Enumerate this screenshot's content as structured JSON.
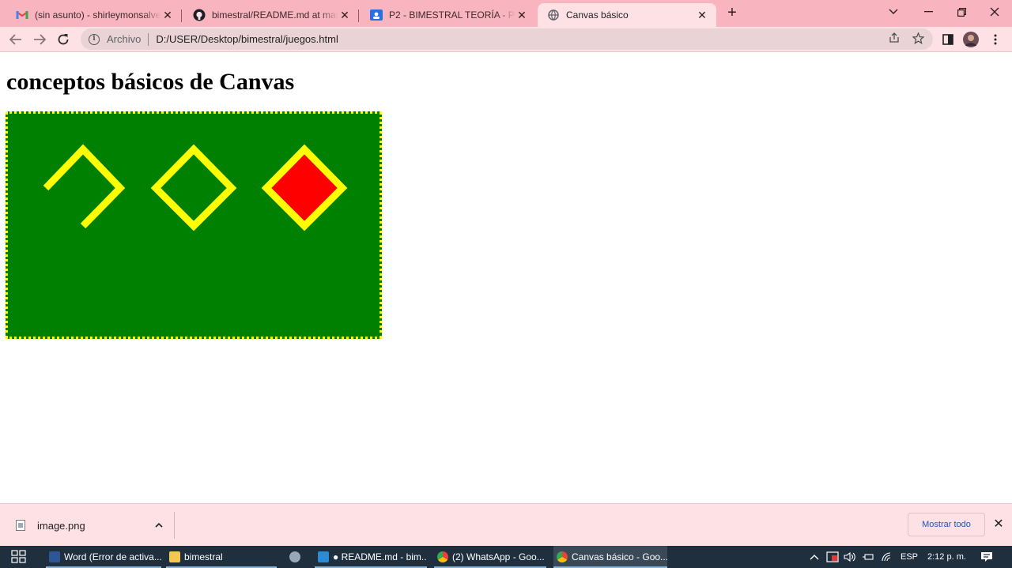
{
  "browser": {
    "tabs": [
      {
        "title": "(sin asunto) - shirleymonsalve@c",
        "icon": "gmail-icon"
      },
      {
        "title": "bimestral/README.md at main · ",
        "icon": "github-icon"
      },
      {
        "title": "P2 - BIMESTRAL TEORÍA - PRÁCTICA",
        "icon": "classroom-icon"
      },
      {
        "title": "Canvas básico",
        "icon": "globe-icon"
      }
    ],
    "new_tab": "+",
    "address": {
      "scheme_label": "Archivo",
      "url": "D:/USER/Desktop/bimestral/juegos.html"
    }
  },
  "page": {
    "heading": "conceptos básicos de Canvas"
  },
  "canvas": {
    "background": "#008000",
    "border_color": "#ffff00",
    "stroke_color": "#ffff00",
    "fill_color": "#ff0000",
    "shapes": [
      "open-diamond-path",
      "closed-diamond-outline",
      "filled-diamond"
    ]
  },
  "download_bar": {
    "file_name": "image.png",
    "show_all_label": "Mostrar todo"
  },
  "taskbar": {
    "items": [
      {
        "label": "Word (Error de activa...",
        "icon": "word-icon"
      },
      {
        "label": "bimestral",
        "icon": "folder-icon"
      },
      {
        "label": "",
        "icon": "app-icon"
      },
      {
        "label": "● README.md - bim...",
        "icon": "vscode-icon"
      },
      {
        "label": "(2) WhatsApp - Goo...",
        "icon": "chrome-icon"
      },
      {
        "label": "Canvas básico - Goo...",
        "icon": "chrome-icon"
      }
    ],
    "tray": {
      "language": "ESP",
      "time": "2:12 p. m."
    }
  }
}
